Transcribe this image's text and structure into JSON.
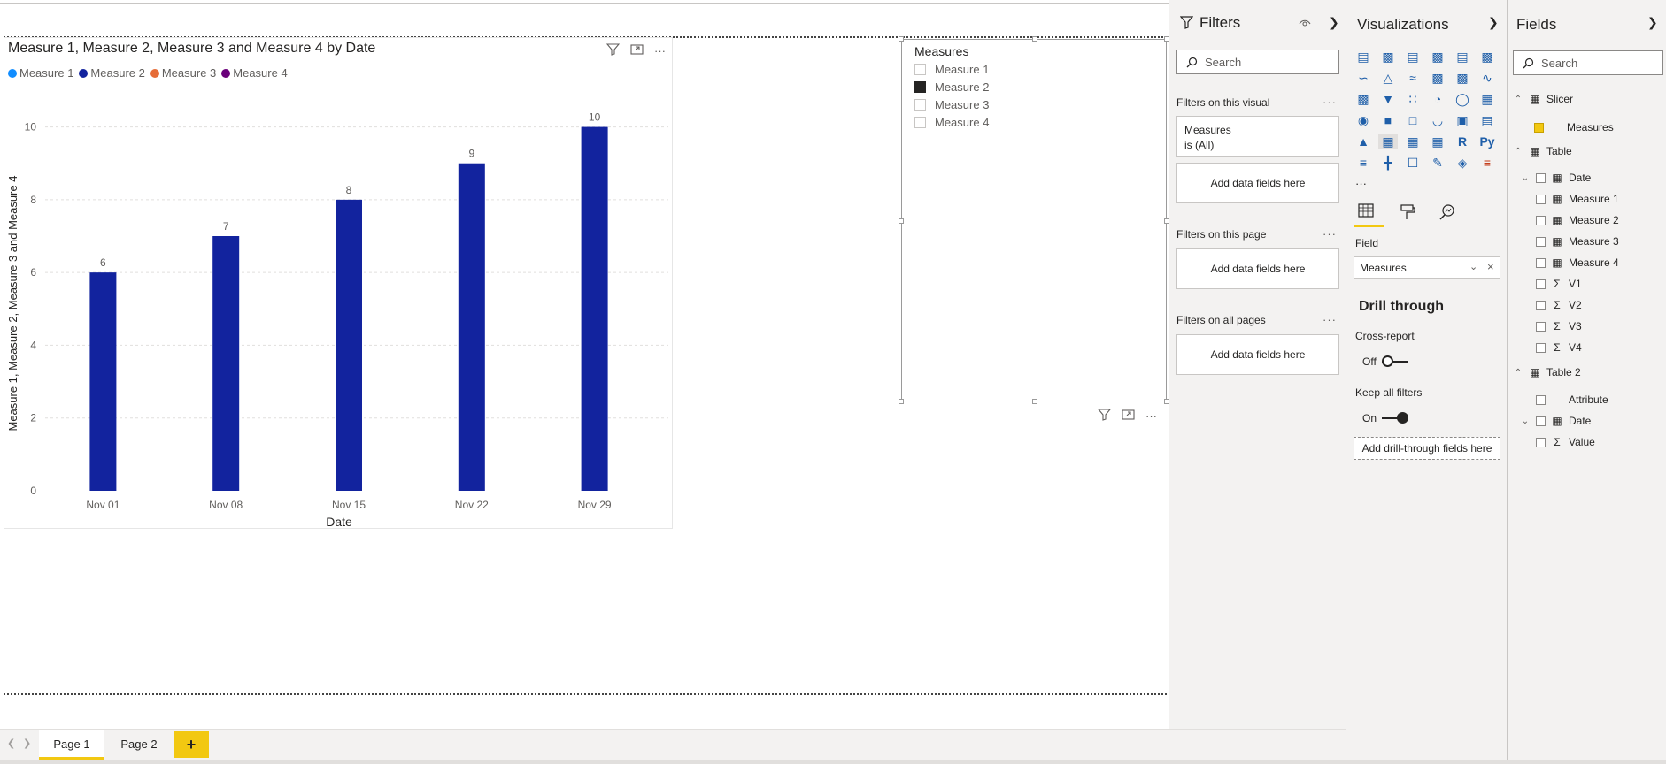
{
  "visual": {
    "title": "Measure 1, Measure 2, Measure 3 and Measure 4 by Date",
    "legend": [
      {
        "label": "Measure 1",
        "color": "#118DFF"
      },
      {
        "label": "Measure 2",
        "color": "#12239E"
      },
      {
        "label": "Measure 3",
        "color": "#E66C37"
      },
      {
        "label": "Measure 4",
        "color": "#6B007B"
      }
    ],
    "header_icons": [
      "filter-icon",
      "focus-mode-icon",
      "more-options-icon"
    ],
    "more_glyph": "···"
  },
  "chart_data": {
    "type": "bar",
    "categories": [
      "Nov 01",
      "Nov 08",
      "Nov 15",
      "Nov 22",
      "Nov 29"
    ],
    "series": [
      {
        "name": "Measure 2",
        "values": [
          6,
          7,
          8,
          9,
          10
        ],
        "color": "#12239E"
      }
    ],
    "xlabel": "Date",
    "ylabel": "Measure 1, Measure 2, Measure 3 and Measure 4",
    "yticks": [
      "0",
      "2",
      "4",
      "6",
      "8",
      "10"
    ],
    "ylim": [
      0,
      10.5
    ],
    "grid": true,
    "legend_position": "top-left",
    "data_labels": [
      "6",
      "7",
      "8",
      "9",
      "10"
    ]
  },
  "slicer": {
    "title": "Measures",
    "items": [
      {
        "label": "Measure 1",
        "checked": false
      },
      {
        "label": "Measure 2",
        "checked": true
      },
      {
        "label": "Measure 3",
        "checked": false
      },
      {
        "label": "Measure 4",
        "checked": false
      }
    ]
  },
  "pages": {
    "tabs": [
      "Page 1",
      "Page 2"
    ],
    "active": "Page 1",
    "add": "+"
  },
  "filters": {
    "title": "Filters",
    "search_placeholder": "Search",
    "on_visual_label": "Filters on this visual",
    "visual_filter_name": "Measures",
    "visual_filter_state": "is (All)",
    "add_fields": "Add data fields here",
    "on_page_label": "Filters on this page",
    "on_all_pages_label": "Filters on all pages",
    "more": "···"
  },
  "visualizations": {
    "title": "Visualizations",
    "more": "···",
    "field_label": "Field",
    "field_value": "Measures",
    "drill_title": "Drill through",
    "cross_report_label": "Cross-report",
    "cross_report_state": "Off",
    "keep_filters_label": "Keep all filters",
    "keep_filters_state": "On",
    "drill_add": "Add drill-through fields here",
    "r_label": "R",
    "py_label": "Py"
  },
  "fields": {
    "title": "Fields",
    "search_placeholder": "Search",
    "tables": [
      {
        "name": "Slicer",
        "items": [
          {
            "name": "Measures",
            "checked": true
          }
        ]
      },
      {
        "name": "Table",
        "items": [
          "Date",
          "Measure 1",
          "Measure 2",
          "Measure 3",
          "Measure 4",
          "V1",
          "V2",
          "V3",
          "V4"
        ]
      },
      {
        "name": "Table 2",
        "items": [
          "Attribute",
          "Date",
          "Value"
        ]
      }
    ]
  }
}
